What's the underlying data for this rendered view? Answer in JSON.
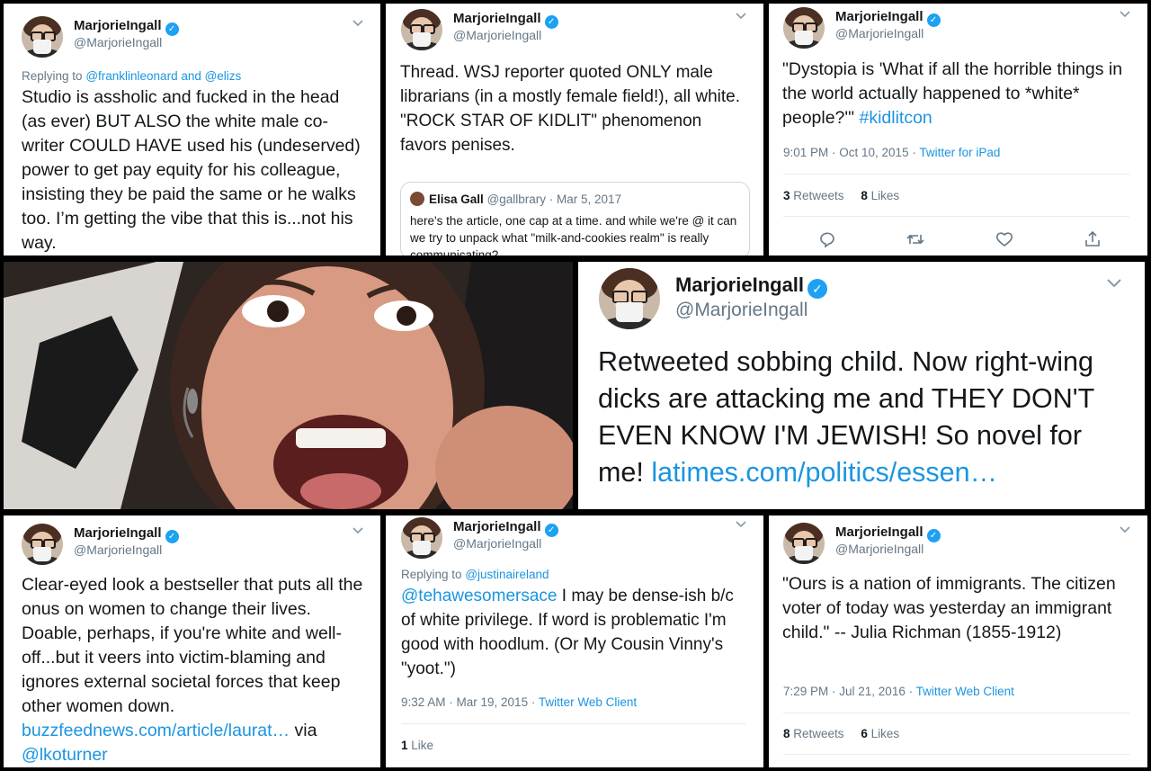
{
  "common": {
    "name": "MarjorieIngall",
    "handle": "@MarjorieIngall",
    "verified_glyph": "✓",
    "accent": "#1da1f2",
    "link_color": "#1b95e0"
  },
  "tweet1": {
    "reply_prefix": "Replying to",
    "reply_users": "@franklinleonard and @elizs",
    "body": "Studio is assholic and fucked in the head (as ever) BUT ALSO the white male co-writer COULD HAVE used his (undeserved) power to get pay equity for his colleague, insisting they be paid the same or he walks too. I’m getting the vibe that this is...not his way."
  },
  "tweet2": {
    "body": "Thread. WSJ reporter quoted ONLY male librarians (in a mostly female field!), all white. \"ROCK STAR OF KIDLIT\" phenomenon favors penises.",
    "quote": {
      "name": "Elisa Gall",
      "handle": "@gallbrary · Mar 5, 2017",
      "text": "here's the article, one cap at a time. and while we're @ it can we try to unpack what \"milk-and-cookies realm\" is really communicating?"
    }
  },
  "tweet3": {
    "body": "\"Dystopia is 'What if all the horrible things in the world actually happened to *white* people?'\"",
    "hashtag": "#kidlitcon",
    "time": "9:01 PM · Oct 10, 2015 ·",
    "client": "Twitter for iPad",
    "retweets": "3",
    "retweets_label": "Retweets",
    "likes": "8",
    "likes_label": "Likes"
  },
  "tweet4": {
    "body": "Retweeted sobbing child. Now right-wing dicks are attacking me and THEY DON'T EVEN KNOW I'M JEWISH! So novel for me!",
    "link": "latimes.com/politics/essen…"
  },
  "tweet5": {
    "body": "Clear-eyed look a bestseller that puts all the onus on women to change their lives. Doable, perhaps, if you're white and well-off...but it veers into victim-blaming and ignores external societal forces that keep other women down.",
    "link": "buzzfeednews.com/article/laurat…",
    "via": "via",
    "mention": "@lkoturner"
  },
  "tweet6": {
    "reply_prefix": "Replying to",
    "reply_users": "@justinaireland",
    "mention": "@tehawesomersace",
    "body": "I may be dense-ish b/c of white privilege. If word is problematic I'm good with hoodlum. (Or My Cousin Vinny's \"yoot.\")",
    "time": "9:32 AM · Mar 19, 2015 ·",
    "client": "Twitter Web Client",
    "likes": "1",
    "likes_label": "Like"
  },
  "tweet7": {
    "body": "\"Ours is a nation of immigrants. The citizen voter of today was yesterday an immigrant child.\"  -- Julia Richman (1855-1912)",
    "time": "7:29 PM · Jul 21, 2016 ·",
    "client": "Twitter Web Client",
    "retweets": "8",
    "retweets_label": "Retweets",
    "likes": "6",
    "likes_label": "Likes"
  },
  "icons": {
    "reply": "reply-icon",
    "retweet": "retweet-icon",
    "like": "heart-icon",
    "share": "share-icon",
    "menu": "chevron-down-icon"
  }
}
